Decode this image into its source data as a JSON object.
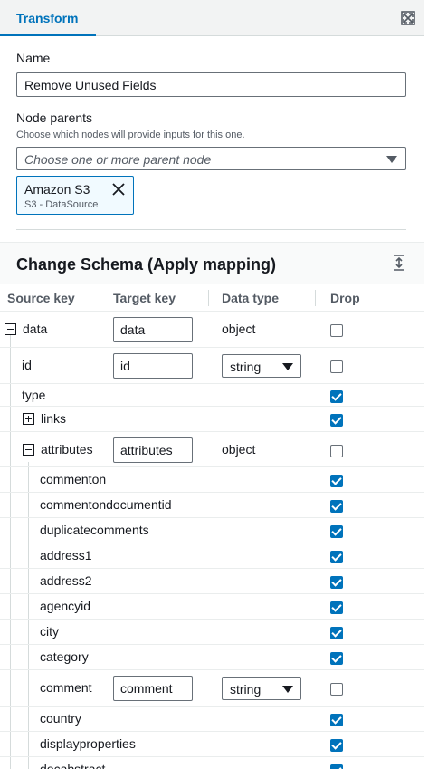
{
  "tabs": [
    {
      "label": "Transform"
    }
  ],
  "expand_icon": "expand-icon",
  "name_field": {
    "label": "Name",
    "value": "Remove Unused Fields"
  },
  "node_parents": {
    "label": "Node parents",
    "description": "Choose which nodes will provide inputs for this one.",
    "placeholder": "Choose one or more parent node",
    "selected": [
      {
        "title": "Amazon S3",
        "subtitle": "S3 - DataSource"
      }
    ]
  },
  "schema": {
    "title": "Change Schema (Apply mapping)",
    "columns": [
      "Source key",
      "Target key",
      "Data type",
      "Drop"
    ],
    "rows": [
      {
        "source": "data",
        "toggle": "minus",
        "target": "data",
        "type_text": "object",
        "drop": false
      },
      {
        "source": "id",
        "target": "id",
        "type_select": "string",
        "drop": false
      },
      {
        "source": "type",
        "drop": true
      },
      {
        "source": "links",
        "toggle": "plus",
        "drop": true
      },
      {
        "source": "attributes",
        "toggle": "minus",
        "target": "attributes",
        "type_text": "object",
        "drop": false
      },
      {
        "source": "commenton",
        "drop": true
      },
      {
        "source": "commentondocumentid",
        "drop": true
      },
      {
        "source": "duplicatecomments",
        "drop": true
      },
      {
        "source": "address1",
        "drop": true
      },
      {
        "source": "address2",
        "drop": true
      },
      {
        "source": "agencyid",
        "drop": true
      },
      {
        "source": "city",
        "drop": true
      },
      {
        "source": "category",
        "drop": true
      },
      {
        "source": "comment",
        "target": "comment",
        "type_select": "string",
        "drop": false
      },
      {
        "source": "country",
        "drop": true
      },
      {
        "source": "displayproperties",
        "drop": true
      },
      {
        "source": "docabstract",
        "drop": true
      }
    ]
  },
  "colors": {
    "accent": "#0073bb",
    "border": "#687078",
    "text": "#16191f",
    "muted": "#545b64"
  }
}
